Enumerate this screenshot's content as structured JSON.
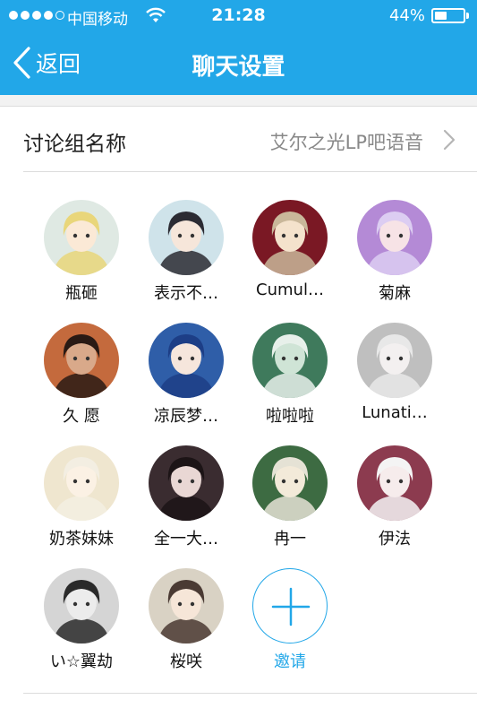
{
  "status_bar": {
    "carrier": "中国移动",
    "time": "21:28",
    "battery": "44%",
    "battery_level": 0.44
  },
  "nav": {
    "back_label": "返回",
    "title": "聊天设置"
  },
  "group_name": {
    "label": "讨论组名称",
    "value": "艾尔之光LP吧语音"
  },
  "members": [
    {
      "name": "瓶砸",
      "bg": "#dfe9e3",
      "hair": "#e9d67a",
      "face": "#fbe9d6"
    },
    {
      "name": "表示不…",
      "bg": "#cfe3ea",
      "hair": "#2b2b33",
      "face": "#f6e6da"
    },
    {
      "name": "Cumul…",
      "bg": "#7a1824",
      "hair": "#c9b79a",
      "face": "#f4e2cc"
    },
    {
      "name": "菊麻",
      "bg": "#b48ad6",
      "hair": "#dccdf2",
      "face": "#f7e3e6"
    },
    {
      "name": "久 愿",
      "bg": "#c46a3d",
      "hair": "#2a1a14",
      "face": "#d9a98a"
    },
    {
      "name": "凉辰梦…",
      "bg": "#2f5ea8",
      "hair": "#1d3e86",
      "face": "#f6e6dc"
    },
    {
      "name": "啦啦啦",
      "bg": "#3f7a5c",
      "hair": "#e7f0ea",
      "face": "#cfe4d6"
    },
    {
      "name": "Lunati…",
      "bg": "#bfbfbf",
      "hair": "#e8e8e8",
      "face": "#f3f0f0"
    },
    {
      "name": "奶茶妹妹",
      "bg": "#efe6cf",
      "hair": "#f3eee2",
      "face": "#fbf1e4"
    },
    {
      "name": "全一大…",
      "bg": "#3a2c30",
      "hair": "#1c1416",
      "face": "#e9d7d4"
    },
    {
      "name": "冉一",
      "bg": "#3d6b42",
      "hair": "#e5e2d5",
      "face": "#f3ead9"
    },
    {
      "name": "伊法",
      "bg": "#8c3b4f",
      "hair": "#f4f4f4",
      "face": "#f6ecec"
    },
    {
      "name": "い☆翼劫",
      "bg": "#d5d5d5",
      "hair": "#2a2a2a",
      "face": "#ececec"
    },
    {
      "name": "桜咲",
      "bg": "#d9d2c4",
      "hair": "#4a3a33",
      "face": "#f6e6d8"
    }
  ],
  "invite": {
    "label": "邀请",
    "accent": "#22a7e8"
  },
  "colors": {
    "header": "#22a7e8",
    "background": "#f2f2f2"
  }
}
